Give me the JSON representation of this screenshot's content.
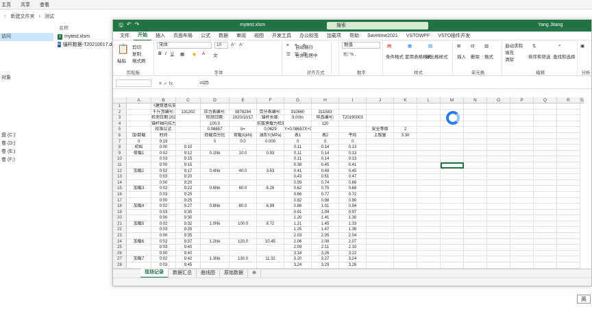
{
  "explorer": {
    "ribbon_tabs": [
      "主页",
      "共享",
      "查看"
    ],
    "breadcrumb": [
      "新建文件夹",
      "测试"
    ],
    "nav_items": [
      "",
      "访问",
      "",
      "",
      "",
      "",
      "",
      "",
      "对象",
      "",
      "",
      "",
      "",
      "",
      "",
      "",
      "",
      "",
      "",
      "",
      "",
      "盘 (C:)",
      "卷 (D:)",
      "卷 (E:)",
      "卷 (F:)"
    ],
    "files_header": "名称",
    "files": [
      "mytest.xlsm",
      "锚杆数据-T20210017.docx"
    ]
  },
  "excel": {
    "title": "mytest.xlsm",
    "search_placeholder": "搜索",
    "user": "Yang Jitang",
    "menu_tabs": [
      "文件",
      "开始",
      "插入",
      "页面布局",
      "公式",
      "数据",
      "审阅",
      "视图",
      "开发工具",
      "办公标签",
      "加载项",
      "帮助",
      "Savetime2021",
      "VSTOWPF",
      "VSTO插件开发"
    ],
    "active_tab": "开始",
    "ribbon": {
      "clipboard": {
        "label": "剪贴板",
        "paste": "粘贴",
        "cut": "剪切",
        "copy": "复制",
        "format_painter": "格式刷"
      },
      "font": {
        "label": "字体",
        "name": "宋体",
        "size": "10"
      },
      "alignment": {
        "label": "对齐方式",
        "wrap": "自动换行",
        "merge": "合并后居中"
      },
      "number": {
        "label": "数字",
        "format": "数值"
      },
      "styles": {
        "label": "样式",
        "cond": "条件格式",
        "table": "套用表格格式",
        "cell": "单元格样式"
      },
      "cells": {
        "label": "单元格",
        "insert": "插入",
        "delete": "删除",
        "format": "格式"
      },
      "editing": {
        "label": "编辑",
        "autosum": "自动求和",
        "fill": "填充",
        "clear": "清除",
        "sort": "排序和筛选",
        "find": "查找和选择"
      },
      "analysis": {
        "label": "分析",
        "analyze": "分析数据"
      }
    },
    "name_box": "",
    "formula": "=I25",
    "columns": [
      "A",
      "B",
      "C",
      "D",
      "E",
      "F",
      "G",
      "H",
      "I",
      "J",
      "K",
      "L",
      "M",
      "N",
      "O",
      "P",
      "Q",
      "R",
      "S"
    ],
    "rows": [
      [
        "1",
        "",
        "《建筑基坑支护技术规程》（JGJ 120-2012）锚杆验收试验",
        "",
        "",
        "",
        "",
        "",
        "",
        "",
        "",
        "",
        "",
        "",
        "",
        "",
        "",
        "",
        ""
      ],
      [
        "2",
        "",
        "千斤顶编号:",
        "131202",
        "压力表编号:",
        "0878284",
        "百分表编号:",
        "310660",
        "311583",
        "",
        "",
        "",
        "",
        "",
        "",
        "",
        "",
        "",
        ""
      ],
      [
        "3",
        "",
        "检测日期:2020/10/17",
        "",
        "检测日期:",
        "2020/10/17",
        "锚杆长度:",
        "9.00m",
        "样品编号:",
        "T20190003",
        "",
        "",
        "",
        "",
        "",
        "",
        "",
        "",
        ""
      ],
      [
        "4",
        "",
        "锚杆轴向拉力标准值Nk",
        "",
        "100.0",
        "",
        "抗拔承载力检测值（KN）",
        "",
        "120",
        "",
        "",
        "",
        "",
        "",
        "",
        "",
        "",
        "",
        ""
      ],
      [
        "5",
        "",
        "校准公式",
        "",
        "0.08657",
        "b=",
        "0.0629",
        "Y=0.08657X+0.0629",
        "",
        "",
        "安全等级",
        "2",
        "",
        "",
        "",
        "",
        "",
        "",
        ""
      ],
      [
        "6",
        "加/卸载",
        "时间",
        "",
        "荷载百分比",
        "荷载X(kN)",
        "油压Y(MPa)",
        "表1",
        "表2",
        "平均",
        "上拔量",
        "3.30",
        "",
        "",
        "",
        "",
        "",
        "",
        ""
      ],
      [
        "7",
        "0",
        "9:19",
        "",
        "0",
        "0.0",
        "0.000",
        "0",
        "0",
        "0",
        "",
        "",
        "",
        "",
        "",
        "",
        "",
        "",
        ""
      ],
      [
        "8",
        "初始",
        "0:00",
        "9:10",
        "",
        "",
        "",
        "0.11",
        "0.14",
        "0.13",
        "",
        "",
        "",
        "",
        "",
        "",
        "",
        "",
        ""
      ],
      [
        "9",
        "荷载1",
        "0:02",
        "9:12",
        "0.1Nk",
        "10.0",
        "0.93",
        "0.11",
        "0.14",
        "0.13",
        "",
        "",
        "",
        "",
        "",
        "",
        "",
        "",
        ""
      ],
      [
        "10",
        "",
        "0:03",
        "9:15",
        "",
        "",
        "",
        "0.11",
        "0.14",
        "0.13",
        "",
        "",
        "",
        "",
        "",
        "",
        "",
        "",
        ""
      ],
      [
        "11",
        "",
        "0:00",
        "9:15",
        "",
        "",
        "",
        "0.38",
        "0.45",
        "0.41",
        "",
        "",
        "",
        "",
        "",
        "",
        "",
        "",
        ""
      ],
      [
        "12",
        "加载2",
        "0:02",
        "9:17",
        "0.4Nk",
        "40.0",
        "3.53",
        "0.41",
        "0.49",
        "0.45",
        "",
        "",
        "",
        "",
        "",
        "",
        "",
        "",
        ""
      ],
      [
        "13",
        "",
        "0:03",
        "9:20",
        "",
        "",
        "",
        "0.43",
        "0.51",
        "0.47",
        "",
        "",
        "",
        "",
        "",
        "",
        "",
        "",
        ""
      ],
      [
        "14",
        "",
        "0:00",
        "9:20",
        "",
        "",
        "",
        "0.59",
        "0.74",
        "0.66",
        "",
        "",
        "",
        "",
        "",
        "",
        "",
        "",
        ""
      ],
      [
        "15",
        "加载3",
        "0:02",
        "9:22",
        "0.6Nk",
        "60.0",
        "5.26",
        "0.62",
        "0.75",
        "0.68",
        "",
        "",
        "",
        "",
        "",
        "",
        "",
        "",
        ""
      ],
      [
        "16",
        "",
        "0:03",
        "9:25",
        "",
        "",
        "",
        "0.66",
        "0.77",
        "0.72",
        "",
        "",
        "",
        "",
        "",
        "",
        "",
        "",
        ""
      ],
      [
        "17",
        "",
        "0:00",
        "9:25",
        "",
        "",
        "",
        "0.82",
        "0.98",
        "0.90",
        "",
        "",
        "",
        "",
        "",
        "",
        "",
        "",
        ""
      ],
      [
        "18",
        "加载4",
        "0:02",
        "9:27",
        "0.8Nk",
        "80.0",
        "6.99",
        "0.86",
        "1.01",
        "0.94",
        "",
        "",
        "",
        "",
        "",
        "",
        "",
        "",
        ""
      ],
      [
        "19",
        "",
        "0:03",
        "9:30",
        "",
        "",
        "",
        "0.91",
        "1.04",
        "0.97",
        "",
        "",
        "",
        "",
        "",
        "",
        "",
        "",
        ""
      ],
      [
        "20",
        "",
        "0:00",
        "9:30",
        "",
        "",
        "",
        "1.20",
        "1.41",
        "1.30",
        "",
        "",
        "",
        "",
        "",
        "",
        "",
        "",
        ""
      ],
      [
        "21",
        "加载5",
        "0:02",
        "9:32",
        "1.0Nk",
        "100.0",
        "8.72",
        "1.21",
        "1.45",
        "1.33",
        "",
        "",
        "",
        "",
        "",
        "",
        "",
        "",
        ""
      ],
      [
        "22",
        "",
        "0:03",
        "9:35",
        "",
        "",
        "",
        "1.25",
        "1.47",
        "1.36",
        "",
        "",
        "",
        "",
        "",
        "",
        "",
        "",
        ""
      ],
      [
        "23",
        "",
        "0:00",
        "9:35",
        "",
        "",
        "",
        "2.03",
        "2.05",
        "2.04",
        "",
        "",
        "",
        "",
        "",
        "",
        "",
        "",
        ""
      ],
      [
        "24",
        "加载6",
        "0:02",
        "9:37",
        "1.2Nk",
        "120.0",
        "10.45",
        "2.06",
        "2.08",
        "2.07",
        "",
        "",
        "",
        "",
        "",
        "",
        "",
        "",
        ""
      ],
      [
        "25",
        "",
        "0:03",
        "9:40",
        "",
        "",
        "",
        "2.09",
        "2.11",
        "2.10",
        "",
        "",
        "",
        "",
        "",
        "",
        "",
        "",
        ""
      ],
      [
        "26",
        "",
        "0:00",
        "9:40",
        "",
        "",
        "",
        "3.18",
        "3.26",
        "3.22",
        "",
        "",
        "",
        "",
        "",
        "",
        "",
        "",
        ""
      ],
      [
        "27",
        "加载7",
        "0:02",
        "9:42",
        "1.3Nk",
        "130.0",
        "11.32",
        "3.20",
        "3.27",
        "3.24",
        "",
        "",
        "",
        "",
        "",
        "",
        "",
        "",
        ""
      ],
      [
        "28",
        "",
        "0:03",
        "9:45",
        "",
        "",
        "",
        "3.24",
        "3.29",
        "3.26",
        "",
        "",
        "",
        "",
        "",
        "",
        "",
        "",
        ""
      ]
    ],
    "sheet_tabs": [
      "现场记录",
      "数据汇总",
      "曲线图",
      "原始数据"
    ],
    "active_sheet": "现场记录",
    "ime": "英"
  }
}
